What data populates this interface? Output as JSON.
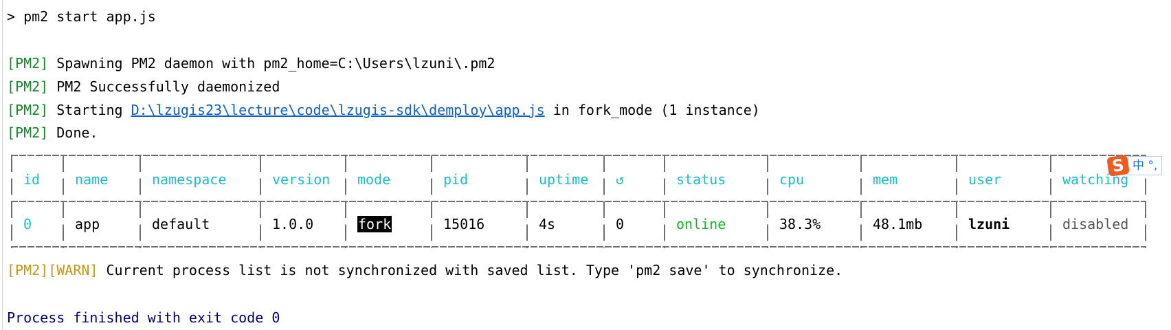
{
  "console": {
    "command": "> pm2 start app.js",
    "lines": [
      {
        "tag": "[PM2]",
        "text": " Spawning PM2 daemon with pm2_home=C:\\Users\\lzuni\\.pm2"
      },
      {
        "tag": "[PM2]",
        "text": " PM2 Successfully daemonized"
      },
      {
        "tag": "[PM2]",
        "text_before": " Starting ",
        "link": "D:\\lzugis23\\lecture\\code\\lzugis-sdk\\demploy\\app.js",
        "text_after": " in fork_mode (1 instance)"
      },
      {
        "tag": "[PM2]",
        "text": " Done."
      }
    ],
    "warning": {
      "tag": "[PM2][WARN]",
      "text": " Current process list is not synchronized with saved list. Type 'pm2 save' to synchronize."
    },
    "exit": "Process finished with exit code 0"
  },
  "table": {
    "headers": [
      "id",
      "name",
      "namespace",
      "version",
      "mode",
      "pid",
      "uptime",
      "↺",
      "status",
      "cpu",
      "mem",
      "user",
      "watching"
    ],
    "row": [
      "0",
      "app",
      "default",
      "1.0.0",
      "fork",
      "15016",
      "4s",
      "0",
      "online",
      "38.3%",
      "48.1mb",
      "lzuni",
      "disabled"
    ]
  },
  "ime": {
    "logo": "S",
    "label": "中 °,"
  },
  "colors": {
    "pm2_tag": "#148a2a",
    "header": "#18c0c8",
    "link": "#1060c8",
    "warn": "#c09a10",
    "online": "#19b02a",
    "exit": "#000080"
  }
}
